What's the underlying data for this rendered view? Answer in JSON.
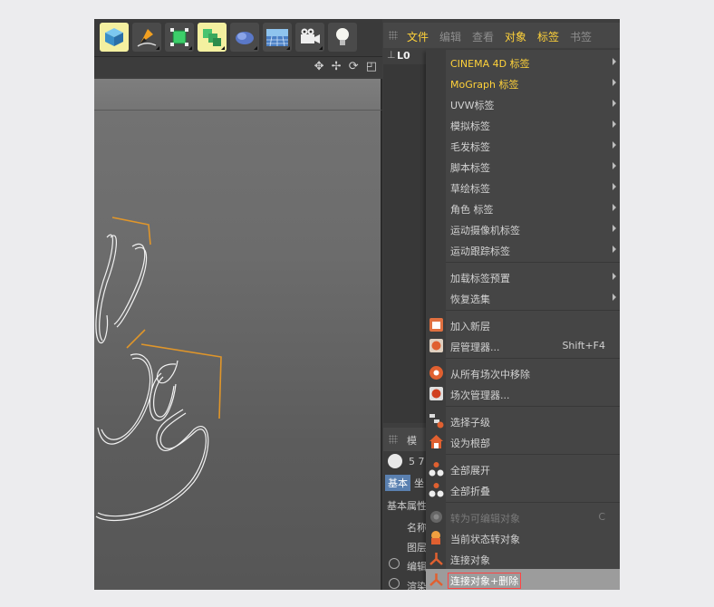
{
  "colors": {
    "accent_yellow": "#ffd23a",
    "highlight": "#9c9c9c",
    "highlight_outline": "#ff4444",
    "curve_orange": "#e0962a"
  },
  "toolbar": {
    "icons": [
      "cube-icon",
      "pen-icon",
      "transform-icon",
      "modifier-icon",
      "deformer-icon",
      "floor-icon",
      "camera-icon",
      "light-icon"
    ]
  },
  "viewport": {
    "nav_icons": "✥ ✢ ⟳ ◰"
  },
  "right_panel": {
    "menus": [
      "文件",
      "编辑",
      "查看",
      "对象",
      "标签",
      "书签"
    ],
    "object_row": "L0",
    "attr_tab": "模",
    "attr_count": "5 7",
    "attr_tab_basic": "基本",
    "attr_tab_coord": "坐",
    "attr_section": "基本属性",
    "attr_rows": [
      "名称",
      "图层",
      "编辑",
      "渲染"
    ]
  },
  "menu": {
    "items": [
      {
        "label": "CINEMA 4D 标签",
        "submenu": true,
        "style": "yellow"
      },
      {
        "label": "MoGraph 标签",
        "submenu": true,
        "style": "yellow"
      },
      {
        "label": "UVW标签",
        "submenu": true
      },
      {
        "label": "模拟标签",
        "submenu": true
      },
      {
        "label": "毛发标签",
        "submenu": true
      },
      {
        "label": "脚本标签",
        "submenu": true
      },
      {
        "label": "草绘标签",
        "submenu": true
      },
      {
        "label": "角色 标签",
        "submenu": true
      },
      {
        "label": "运动摄像机标签",
        "submenu": true
      },
      {
        "label": "运动跟踪标签",
        "submenu": true
      },
      {
        "label": "加载标签预置",
        "submenu": true
      },
      {
        "label": "恢复选集",
        "submenu": true
      },
      {
        "label": "加入新层"
      },
      {
        "label": "层管理器...",
        "shortcut": "Shift+F4"
      },
      {
        "label": "从所有场次中移除"
      },
      {
        "label": "场次管理器..."
      },
      {
        "label": "选择子级"
      },
      {
        "label": "设为根部"
      },
      {
        "label": "全部展开"
      },
      {
        "label": "全部折叠"
      },
      {
        "label": "转为可编辑对象",
        "shortcut": "C",
        "style": "disabled"
      },
      {
        "label": "当前状态转对象"
      },
      {
        "label": "连接对象"
      },
      {
        "label": "连接对象+删除",
        "style": "highlight"
      }
    ]
  }
}
